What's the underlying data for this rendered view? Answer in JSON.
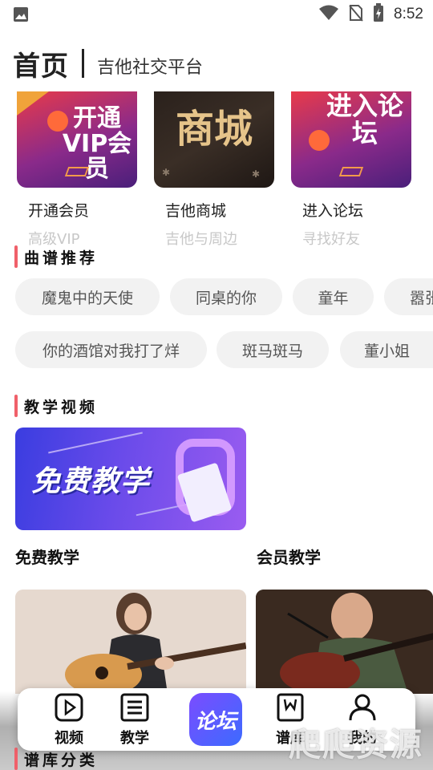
{
  "status_bar": {
    "time": "8:52",
    "icons": [
      "image-icon",
      "wifi-icon",
      "no-sim-icon",
      "battery-charging-icon"
    ]
  },
  "header": {
    "title": "首页",
    "subtitle": "吉他社交平台"
  },
  "banners": [
    {
      "image_text": "开通VIP会员",
      "label": "开通会员",
      "sub": "高级VIP"
    },
    {
      "image_text": "商城",
      "label": "吉他商城",
      "sub": "吉他与周边"
    },
    {
      "image_text": "进入论坛",
      "label": "进入论坛",
      "sub": "寻找好友"
    }
  ],
  "score_section": {
    "title": "曲谱推荐",
    "chips_row1": [
      "魔鬼中的天使",
      "同桌的你",
      "童年",
      "嚣张"
    ],
    "chips_row2": [
      "你的酒馆对我打了烊",
      "斑马斑马",
      "董小姐"
    ]
  },
  "video_section": {
    "title": "教学视频",
    "banner_text": "免费教学",
    "free_label": "免费教学",
    "member_label": "会员教学"
  },
  "bottom_nav": {
    "items": [
      {
        "label": "视频",
        "icon": "play-icon"
      },
      {
        "label": "教学",
        "icon": "list-icon"
      },
      {
        "label": "论坛",
        "icon": "forum-icon"
      },
      {
        "label": "谱库",
        "icon": "score-book-icon"
      },
      {
        "label": "我的",
        "icon": "user-icon"
      }
    ]
  },
  "lower_section": {
    "title": "谱库分类"
  },
  "watermark": "爬爬资源",
  "colors": {
    "accent_bar": "#f0606a",
    "chip_bg": "#f2f2f2",
    "muted_text": "#c8c8c8",
    "forum_gradient_start": "#7b4cff",
    "forum_gradient_end": "#3c6bff"
  }
}
